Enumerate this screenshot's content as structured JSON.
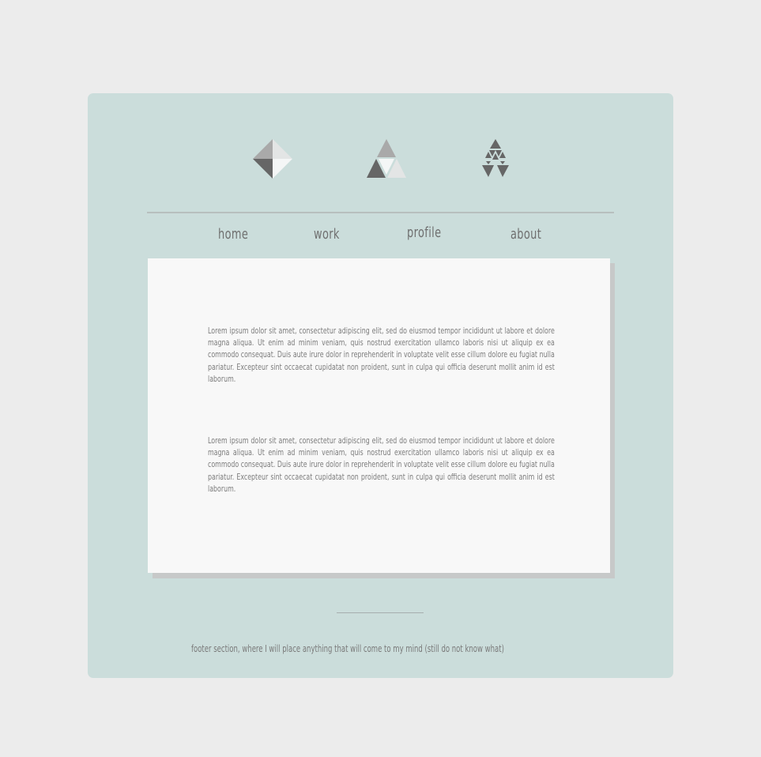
{
  "logos": [
    {
      "icon": "diamond-shaded-icon"
    },
    {
      "icon": "triangle-split-icon"
    },
    {
      "icon": "triangle-mosaic-icon"
    }
  ],
  "nav": {
    "items": [
      {
        "label": "home"
      },
      {
        "label": "work"
      },
      {
        "label": "profile"
      },
      {
        "label": "about"
      }
    ]
  },
  "main": {
    "paragraphs": [
      "Lorem ipsum dolor sit amet, consectetur adipiscing elit, sed do eiusmod tempor incididunt ut labore et dolore magna aliqua. Ut enim ad minim veniam, quis nostrud exercitation ullamco laboris nisi ut aliquip ex ea commodo consequat. Duis aute irure dolor in reprehenderit in voluptate velit esse cillum dolore eu fugiat nulla pariatur. Excepteur sint occaecat cupidatat non proident, sunt in culpa qui officia deserunt mollit anim id est laborum.",
      "Lorem ipsum dolor sit amet, consectetur adipiscing elit, sed do eiusmod tempor incididunt ut labore et dolore magna aliqua. Ut enim ad minim veniam, quis nostrud exercitation ullamco laboris nisi ut aliquip ex ea commodo consequat. Duis aute irure dolor in reprehenderit in voluptate velit esse cillum dolore eu fugiat nulla pariatur. Excepteur sint occaecat cupidatat non proident, sunt in culpa qui officia deserunt mollit anim id est laborum."
    ]
  },
  "footer": {
    "text": "footer section, where I will place anything that will come to my mind (still do not know what)"
  },
  "colors": {
    "page_background": "#ececec",
    "card_background": "#cbdddb",
    "content_background": "#f8f8f8",
    "content_shadow": "#c7c9c9",
    "text": "#7c7c7c",
    "icon_dark": "#666666",
    "icon_mid": "#a9a9a9",
    "icon_light": "#e3e5e5"
  }
}
